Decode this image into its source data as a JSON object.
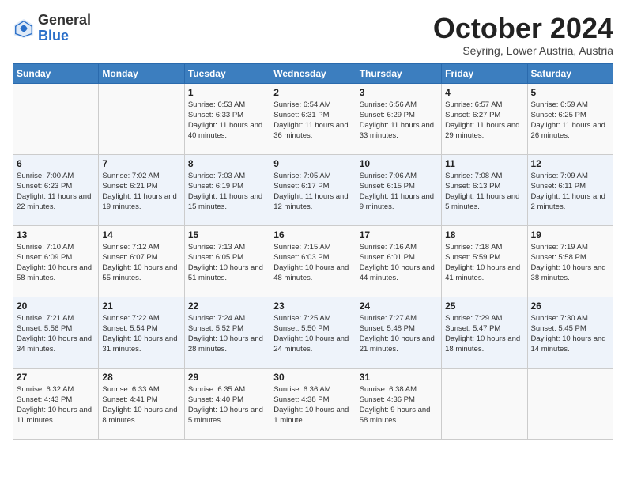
{
  "header": {
    "logo_general": "General",
    "logo_blue": "Blue",
    "month_title": "October 2024",
    "subtitle": "Seyring, Lower Austria, Austria"
  },
  "weekdays": [
    "Sunday",
    "Monday",
    "Tuesday",
    "Wednesday",
    "Thursday",
    "Friday",
    "Saturday"
  ],
  "weeks": [
    [
      {
        "day": "",
        "sunrise": "",
        "sunset": "",
        "daylight": ""
      },
      {
        "day": "",
        "sunrise": "",
        "sunset": "",
        "daylight": ""
      },
      {
        "day": "1",
        "sunrise": "Sunrise: 6:53 AM",
        "sunset": "Sunset: 6:33 PM",
        "daylight": "Daylight: 11 hours and 40 minutes."
      },
      {
        "day": "2",
        "sunrise": "Sunrise: 6:54 AM",
        "sunset": "Sunset: 6:31 PM",
        "daylight": "Daylight: 11 hours and 36 minutes."
      },
      {
        "day": "3",
        "sunrise": "Sunrise: 6:56 AM",
        "sunset": "Sunset: 6:29 PM",
        "daylight": "Daylight: 11 hours and 33 minutes."
      },
      {
        "day": "4",
        "sunrise": "Sunrise: 6:57 AM",
        "sunset": "Sunset: 6:27 PM",
        "daylight": "Daylight: 11 hours and 29 minutes."
      },
      {
        "day": "5",
        "sunrise": "Sunrise: 6:59 AM",
        "sunset": "Sunset: 6:25 PM",
        "daylight": "Daylight: 11 hours and 26 minutes."
      }
    ],
    [
      {
        "day": "6",
        "sunrise": "Sunrise: 7:00 AM",
        "sunset": "Sunset: 6:23 PM",
        "daylight": "Daylight: 11 hours and 22 minutes."
      },
      {
        "day": "7",
        "sunrise": "Sunrise: 7:02 AM",
        "sunset": "Sunset: 6:21 PM",
        "daylight": "Daylight: 11 hours and 19 minutes."
      },
      {
        "day": "8",
        "sunrise": "Sunrise: 7:03 AM",
        "sunset": "Sunset: 6:19 PM",
        "daylight": "Daylight: 11 hours and 15 minutes."
      },
      {
        "day": "9",
        "sunrise": "Sunrise: 7:05 AM",
        "sunset": "Sunset: 6:17 PM",
        "daylight": "Daylight: 11 hours and 12 minutes."
      },
      {
        "day": "10",
        "sunrise": "Sunrise: 7:06 AM",
        "sunset": "Sunset: 6:15 PM",
        "daylight": "Daylight: 11 hours and 9 minutes."
      },
      {
        "day": "11",
        "sunrise": "Sunrise: 7:08 AM",
        "sunset": "Sunset: 6:13 PM",
        "daylight": "Daylight: 11 hours and 5 minutes."
      },
      {
        "day": "12",
        "sunrise": "Sunrise: 7:09 AM",
        "sunset": "Sunset: 6:11 PM",
        "daylight": "Daylight: 11 hours and 2 minutes."
      }
    ],
    [
      {
        "day": "13",
        "sunrise": "Sunrise: 7:10 AM",
        "sunset": "Sunset: 6:09 PM",
        "daylight": "Daylight: 10 hours and 58 minutes."
      },
      {
        "day": "14",
        "sunrise": "Sunrise: 7:12 AM",
        "sunset": "Sunset: 6:07 PM",
        "daylight": "Daylight: 10 hours and 55 minutes."
      },
      {
        "day": "15",
        "sunrise": "Sunrise: 7:13 AM",
        "sunset": "Sunset: 6:05 PM",
        "daylight": "Daylight: 10 hours and 51 minutes."
      },
      {
        "day": "16",
        "sunrise": "Sunrise: 7:15 AM",
        "sunset": "Sunset: 6:03 PM",
        "daylight": "Daylight: 10 hours and 48 minutes."
      },
      {
        "day": "17",
        "sunrise": "Sunrise: 7:16 AM",
        "sunset": "Sunset: 6:01 PM",
        "daylight": "Daylight: 10 hours and 44 minutes."
      },
      {
        "day": "18",
        "sunrise": "Sunrise: 7:18 AM",
        "sunset": "Sunset: 5:59 PM",
        "daylight": "Daylight: 10 hours and 41 minutes."
      },
      {
        "day": "19",
        "sunrise": "Sunrise: 7:19 AM",
        "sunset": "Sunset: 5:58 PM",
        "daylight": "Daylight: 10 hours and 38 minutes."
      }
    ],
    [
      {
        "day": "20",
        "sunrise": "Sunrise: 7:21 AM",
        "sunset": "Sunset: 5:56 PM",
        "daylight": "Daylight: 10 hours and 34 minutes."
      },
      {
        "day": "21",
        "sunrise": "Sunrise: 7:22 AM",
        "sunset": "Sunset: 5:54 PM",
        "daylight": "Daylight: 10 hours and 31 minutes."
      },
      {
        "day": "22",
        "sunrise": "Sunrise: 7:24 AM",
        "sunset": "Sunset: 5:52 PM",
        "daylight": "Daylight: 10 hours and 28 minutes."
      },
      {
        "day": "23",
        "sunrise": "Sunrise: 7:25 AM",
        "sunset": "Sunset: 5:50 PM",
        "daylight": "Daylight: 10 hours and 24 minutes."
      },
      {
        "day": "24",
        "sunrise": "Sunrise: 7:27 AM",
        "sunset": "Sunset: 5:48 PM",
        "daylight": "Daylight: 10 hours and 21 minutes."
      },
      {
        "day": "25",
        "sunrise": "Sunrise: 7:29 AM",
        "sunset": "Sunset: 5:47 PM",
        "daylight": "Daylight: 10 hours and 18 minutes."
      },
      {
        "day": "26",
        "sunrise": "Sunrise: 7:30 AM",
        "sunset": "Sunset: 5:45 PM",
        "daylight": "Daylight: 10 hours and 14 minutes."
      }
    ],
    [
      {
        "day": "27",
        "sunrise": "Sunrise: 6:32 AM",
        "sunset": "Sunset: 4:43 PM",
        "daylight": "Daylight: 10 hours and 11 minutes."
      },
      {
        "day": "28",
        "sunrise": "Sunrise: 6:33 AM",
        "sunset": "Sunset: 4:41 PM",
        "daylight": "Daylight: 10 hours and 8 minutes."
      },
      {
        "day": "29",
        "sunrise": "Sunrise: 6:35 AM",
        "sunset": "Sunset: 4:40 PM",
        "daylight": "Daylight: 10 hours and 5 minutes."
      },
      {
        "day": "30",
        "sunrise": "Sunrise: 6:36 AM",
        "sunset": "Sunset: 4:38 PM",
        "daylight": "Daylight: 10 hours and 1 minute."
      },
      {
        "day": "31",
        "sunrise": "Sunrise: 6:38 AM",
        "sunset": "Sunset: 4:36 PM",
        "daylight": "Daylight: 9 hours and 58 minutes."
      },
      {
        "day": "",
        "sunrise": "",
        "sunset": "",
        "daylight": ""
      },
      {
        "day": "",
        "sunrise": "",
        "sunset": "",
        "daylight": ""
      }
    ]
  ]
}
